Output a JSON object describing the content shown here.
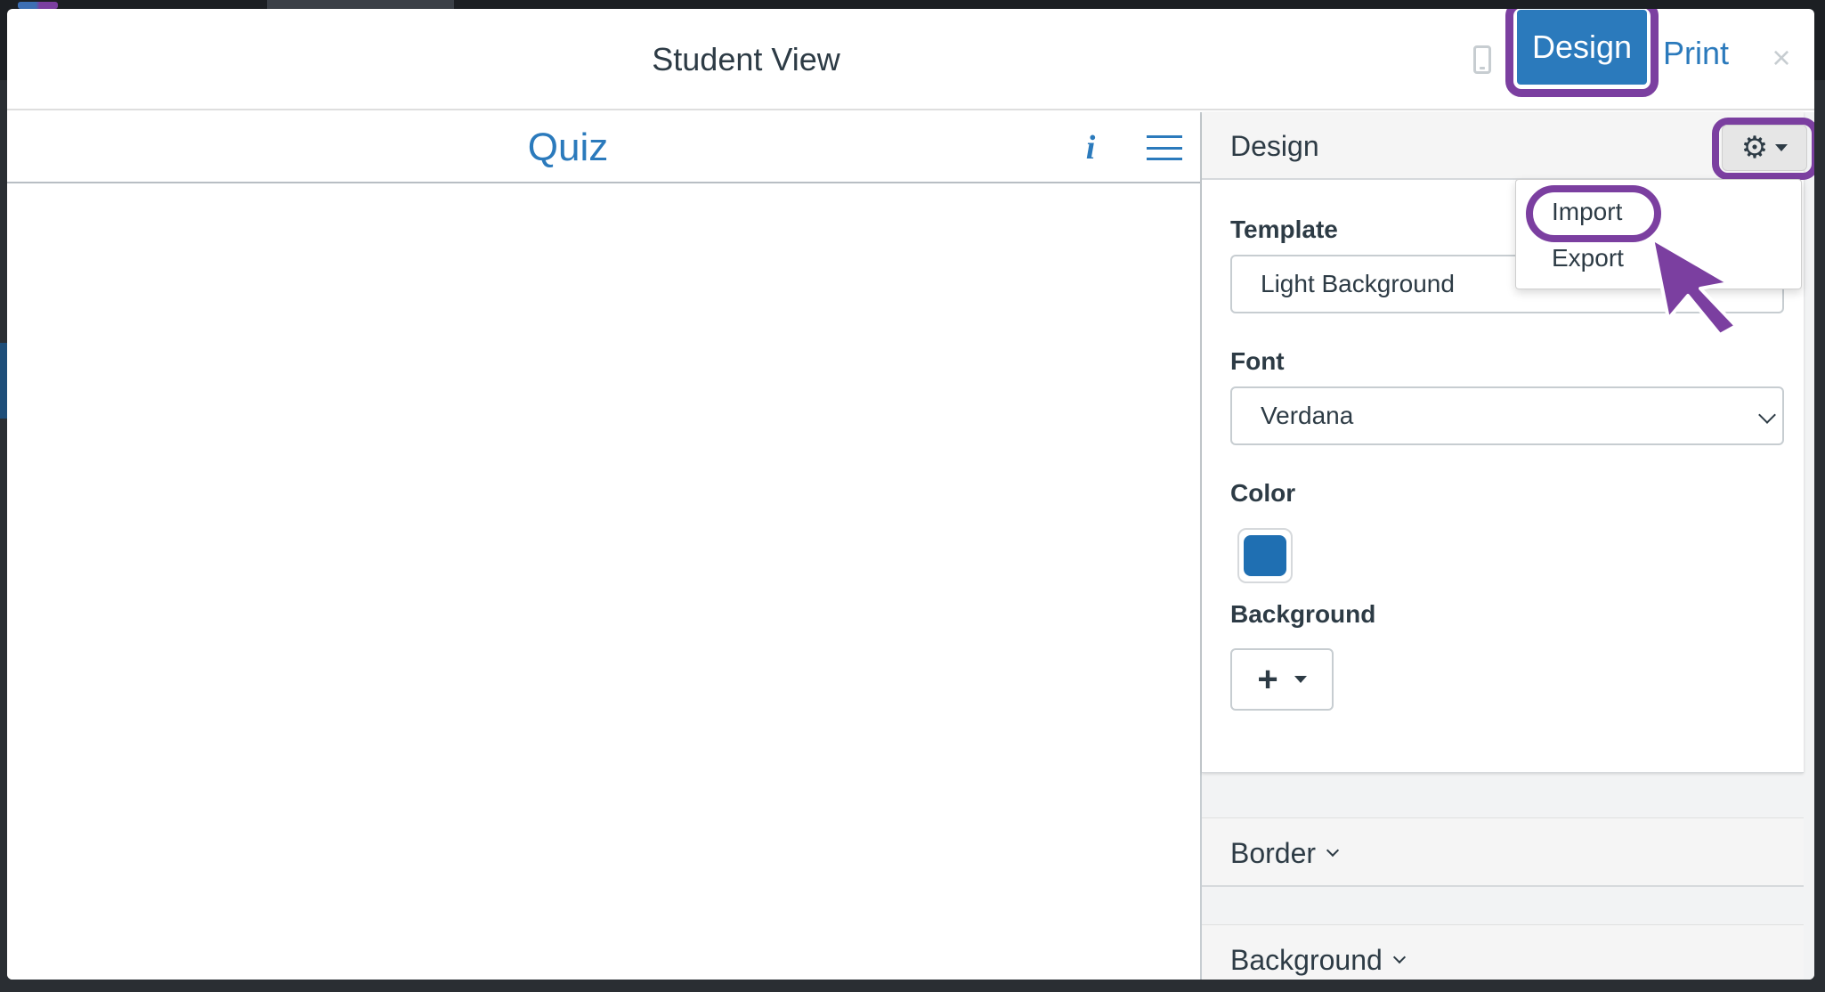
{
  "modal": {
    "title": "Student View",
    "design_button": "Design",
    "print_link": "Print",
    "close_glyph": "×"
  },
  "preview": {
    "title": "Quiz",
    "info_glyph": "i"
  },
  "panel": {
    "title": "Design",
    "gear_glyph": "⚙",
    "template_label": "Template",
    "template_value": "Light Background",
    "font_label": "Font",
    "font_value": "Verdana",
    "color_label": "Color",
    "color_value": "#1f6fb2",
    "background_label": "Background",
    "plus_glyph": "+",
    "sections": [
      {
        "label": "Border"
      },
      {
        "label": "Background"
      }
    ]
  },
  "dropdown": {
    "items": [
      {
        "label": "Import"
      },
      {
        "label": "Export"
      }
    ]
  },
  "colors": {
    "accent": "#2b7abc",
    "highlight": "#7b3fa0",
    "text": "#2d3b45"
  }
}
